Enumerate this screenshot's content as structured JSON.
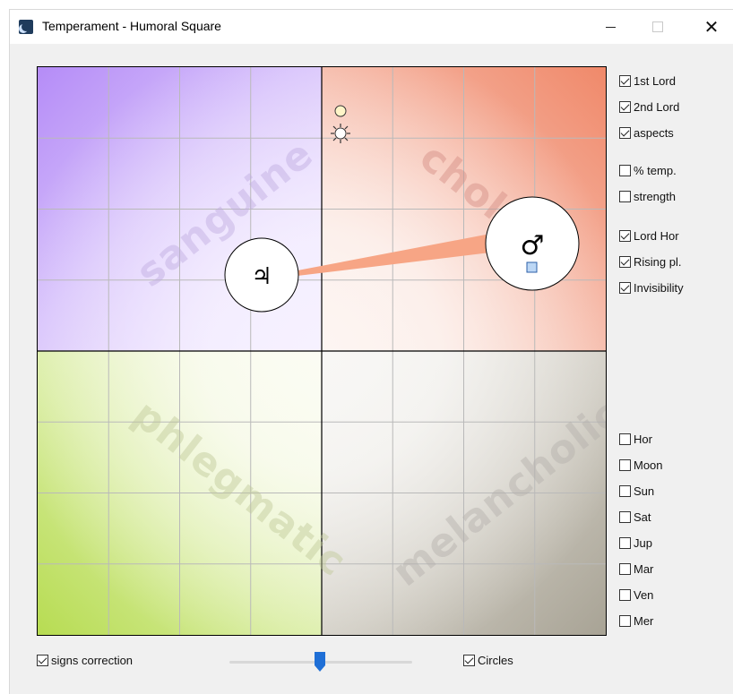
{
  "window": {
    "title": "Temperament - Humoral Square",
    "icons": {
      "app": "moon-app-icon",
      "minimize": "minimize-icon",
      "maximize": "maximize-icon",
      "close": "close-icon"
    },
    "close_glyph": "✕"
  },
  "quadrants": {
    "top_left": {
      "label": "sanguine",
      "color": "#b58cf7"
    },
    "top_right": {
      "label": "chole",
      "color": "#f0896a"
    },
    "bottom_left": {
      "label": "phlegmatic",
      "color": "#b7dc52"
    },
    "bottom_right": {
      "label": "melancholic",
      "color": "#a8a395"
    }
  },
  "planets": {
    "jupiter": {
      "glyph": "♃",
      "icon": "jupiter-icon"
    },
    "mars": {
      "glyph": "♂",
      "icon": "mars-icon"
    },
    "small_markers": [
      "moon-marker-icon",
      "sun-marker-icon",
      "rising-square-icon"
    ]
  },
  "aspect_color": "#f7a585",
  "options_top": [
    {
      "label": "1st Lord",
      "checked": true
    },
    {
      "label": "2nd Lord",
      "checked": true
    },
    {
      "label": "aspects",
      "checked": true
    },
    {
      "label": "% temp.",
      "checked": false
    },
    {
      "label": "strength",
      "checked": false
    },
    {
      "label": "Lord Hor",
      "checked": true
    },
    {
      "label": "Rising pl.",
      "checked": true
    },
    {
      "label": "Invisibility",
      "checked": true
    }
  ],
  "options_planets": [
    {
      "label": "Hor",
      "checked": false
    },
    {
      "label": "Moon",
      "checked": false
    },
    {
      "label": "Sun",
      "checked": false
    },
    {
      "label": "Sat",
      "checked": false
    },
    {
      "label": "Jup",
      "checked": false
    },
    {
      "label": "Mar",
      "checked": false
    },
    {
      "label": "Ven",
      "checked": false
    },
    {
      "label": "Mer",
      "checked": false
    }
  ],
  "bottom": {
    "signs_correction": {
      "label": "signs correction",
      "checked": true
    },
    "circles": {
      "label": "Circles",
      "checked": true
    },
    "slider": {
      "value_fraction": 0.47,
      "color": "#1f6fd6"
    }
  }
}
